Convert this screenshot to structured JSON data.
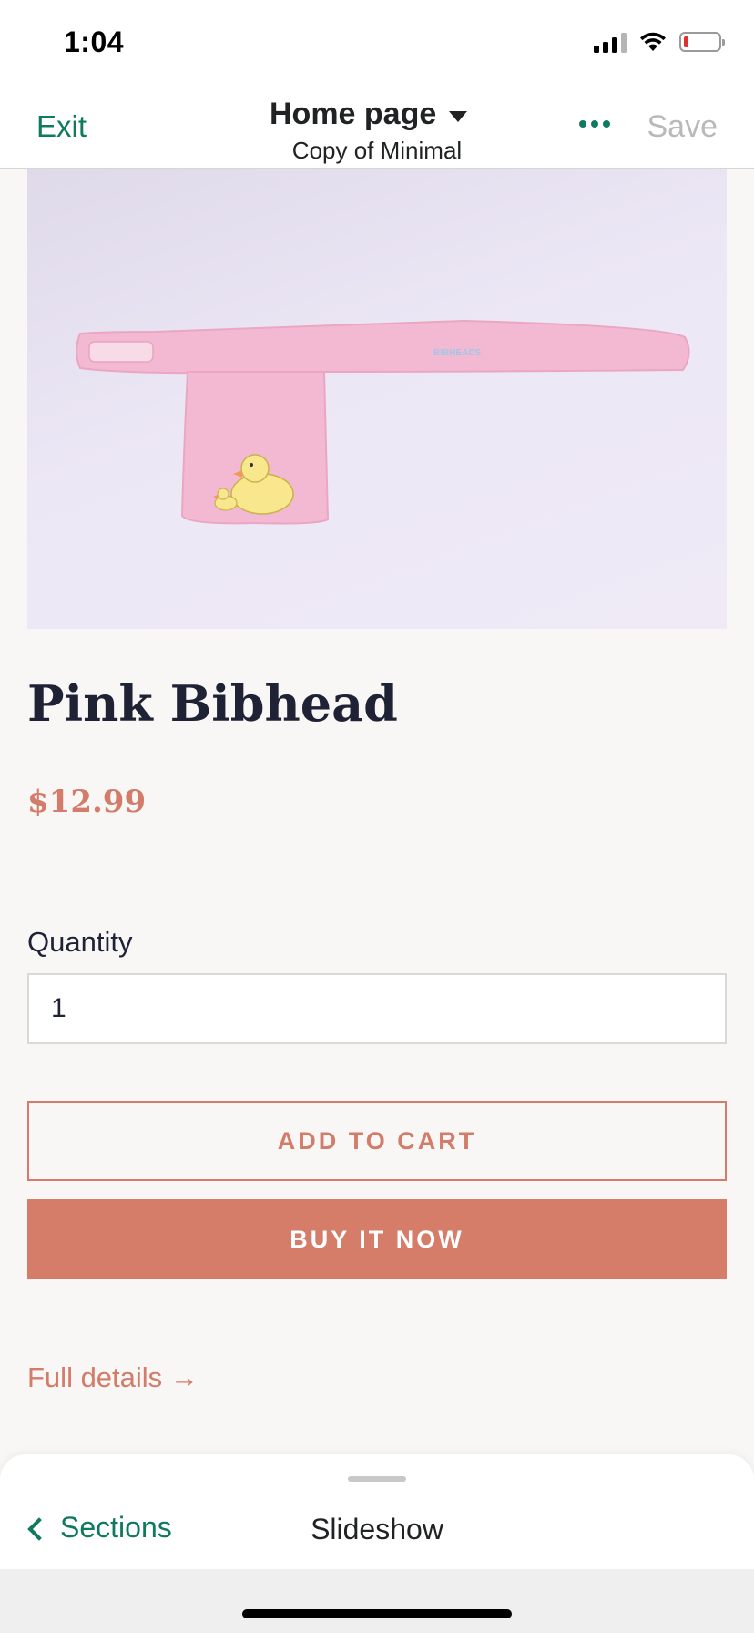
{
  "status_bar": {
    "time": "1:04",
    "icons": [
      "cellular-signal-icon",
      "wifi-icon",
      "battery-low-icon"
    ]
  },
  "editor_header": {
    "exit_label": "Exit",
    "page_title": "Home page",
    "theme_name": "Copy of Minimal",
    "more_icon": "more-horizontal-icon",
    "save_label": "Save",
    "colors": {
      "accent": "#0f7a5f",
      "disabled": "#b9b9b9"
    }
  },
  "product": {
    "image_icon": "product-photo-pink-bibhead",
    "title": "Pink Bibhead",
    "price": "$12.99",
    "quantity_label": "Quantity",
    "quantity_value": "1",
    "add_to_cart_label": "ADD TO CART",
    "buy_now_label": "BUY IT NOW",
    "full_details_label": "Full details →",
    "colors": {
      "accent": "#d27c69",
      "buy_button": "#d67d6a",
      "title": "#1f2235"
    }
  },
  "bottom_sheet": {
    "back_label": "Sections",
    "title": "Slideshow"
  }
}
